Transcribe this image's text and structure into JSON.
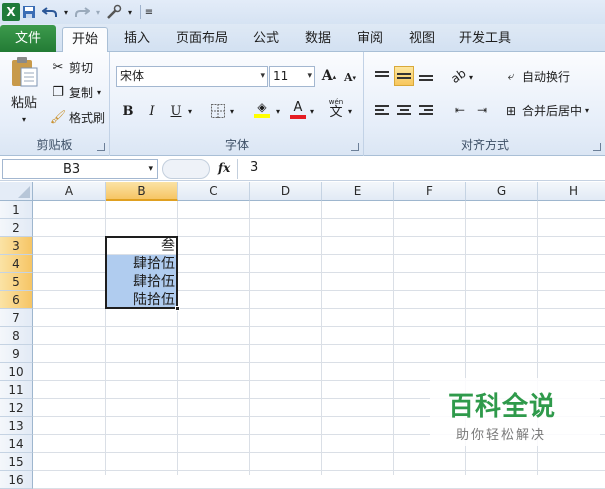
{
  "quick_access": {
    "excel_icon": "X"
  },
  "tabs": [
    "文件",
    "开始",
    "插入",
    "页面布局",
    "公式",
    "数据",
    "审阅",
    "视图",
    "开发工具"
  ],
  "active_tab": "开始",
  "clipboard": {
    "paste": "粘贴",
    "cut": "剪切",
    "copy": "复制",
    "format_painter": "格式刷",
    "label": "剪贴板"
  },
  "font": {
    "name": "宋体",
    "size": "11",
    "bold": "B",
    "italic": "I",
    "underline": "U",
    "label": "字体",
    "grow": "A",
    "shrink": "A",
    "phonetic": "文"
  },
  "alignment": {
    "wrap": "自动换行",
    "merge": "合并后居中",
    "label": "对齐方式"
  },
  "formula_bar": {
    "name_box": "B3",
    "fx": "fx",
    "value": "3"
  },
  "columns": [
    "A",
    "B",
    "C",
    "D",
    "E",
    "F",
    "G",
    "H"
  ],
  "rows": [
    "1",
    "2",
    "3",
    "4",
    "5",
    "6",
    "7",
    "8",
    "9",
    "10",
    "11",
    "12",
    "13",
    "14",
    "15",
    "16"
  ],
  "cells": {
    "B3": "叁",
    "B4": "肆拾伍",
    "B5": "肆拾伍",
    "B6": "陆拾伍"
  },
  "watermark": {
    "title": "百科全说",
    "subtitle": "助你轻松解决"
  },
  "colors": {
    "file_tab": "#237b35",
    "selection_fill": "#b0ccef",
    "header_highlight": "#f6c565",
    "watermark": "#2f9a4b"
  }
}
